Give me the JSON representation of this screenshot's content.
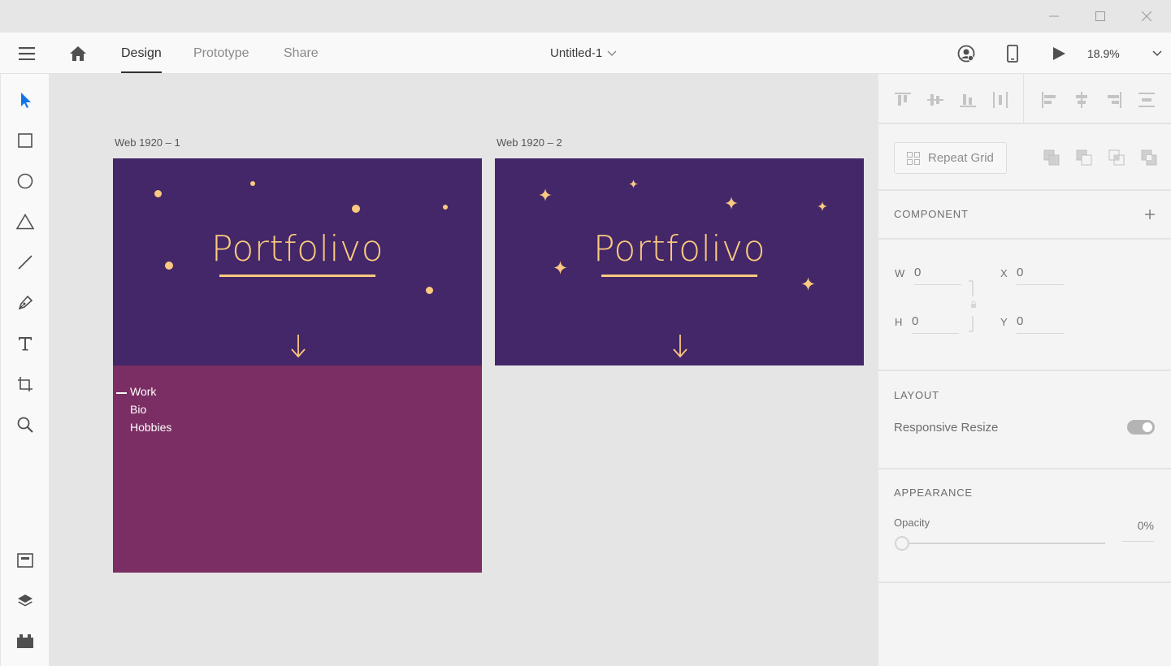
{
  "window": {
    "minimize_icon": "minimize-icon",
    "maximize_icon": "maximize-icon",
    "close_icon": "close-icon"
  },
  "header": {
    "menu_icon": "hamburger-menu-icon",
    "home_icon": "home-icon",
    "tabs": [
      {
        "label": "Design",
        "active": true
      },
      {
        "label": "Prototype",
        "active": false
      },
      {
        "label": "Share",
        "active": false
      }
    ],
    "document_title": "Untitled-1",
    "zoom": "18.9%",
    "right_icons": [
      "account-icon",
      "device-preview-icon",
      "play-icon"
    ]
  },
  "tools": [
    "select-tool-icon",
    "rectangle-tool-icon",
    "ellipse-tool-icon",
    "polygon-tool-icon",
    "line-tool-icon",
    "pen-tool-icon",
    "text-tool-icon",
    "artboard-tool-icon",
    "zoom-tool-icon",
    "assets-icon",
    "layers-icon",
    "plugins-icon"
  ],
  "canvas": {
    "artboards": [
      {
        "label": "Web 1920 – 1",
        "title": "Portfolivo"
      },
      {
        "label": "Web 1920 – 2",
        "title": "Portfolivo"
      }
    ],
    "nav_items": [
      "Work",
      "Bio",
      "Hobbies"
    ]
  },
  "inspector": {
    "repeat_grid": "Repeat Grid",
    "component": "COMPONENT",
    "w_label": "W",
    "w": "0",
    "h_label": "H",
    "h": "0",
    "x_label": "X",
    "x": "0",
    "y_label": "Y",
    "y": "0",
    "layout": "LAYOUT",
    "responsive_resize": "Responsive Resize",
    "responsive_resize_on": true,
    "appearance": "APPEARANCE",
    "opacity_label": "Opacity",
    "opacity": "0%"
  },
  "colors": {
    "hero": "#432768",
    "section": "#7b2e63",
    "accent": "#fbc97f",
    "select_blue": "#1473e6"
  }
}
